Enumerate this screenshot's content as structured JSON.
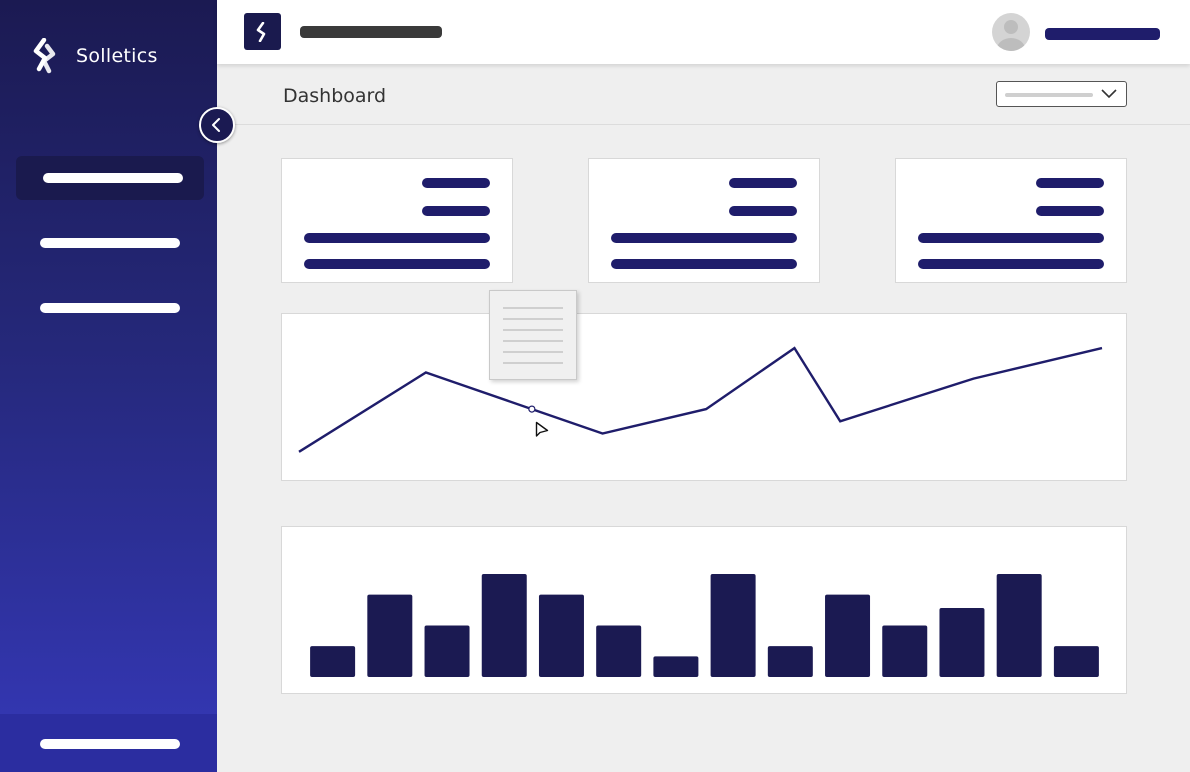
{
  "app": {
    "brand_name": "Solletics",
    "page_title": "Dashboard"
  },
  "colors": {
    "sidebar_dark": "#1b1a52",
    "sidebar_light": "#3538b8",
    "accent": "#1f1d6b",
    "background": "#efefef"
  },
  "icons": {
    "brand_logo": "solletics-logo-icon",
    "collapse": "chevron-left-icon",
    "select_arrow": "chevron-down-icon",
    "cursor": "mouse-pointer-icon",
    "avatar": "user-avatar-icon"
  },
  "sidebar": {
    "nav_items": [
      {
        "state": "active"
      },
      {
        "state": "inactive"
      },
      {
        "state": "inactive"
      }
    ]
  },
  "stat_cards": [
    {},
    {},
    {}
  ],
  "chart_data": [
    {
      "type": "line",
      "x": [
        1,
        2,
        3,
        4,
        5,
        6,
        7,
        8,
        9
      ],
      "series": [
        {
          "values": [
            10,
            75,
            45,
            25,
            45,
            95,
            35,
            70,
            95
          ]
        }
      ],
      "ylim": [
        0,
        100
      ],
      "grid": false,
      "hover_point_index": 2
    },
    {
      "type": "bar",
      "values": [
        30,
        80,
        50,
        100,
        80,
        50,
        20,
        100,
        30,
        80,
        50,
        67,
        100,
        30
      ],
      "ylim": [
        0,
        100
      ],
      "grid": false
    }
  ]
}
